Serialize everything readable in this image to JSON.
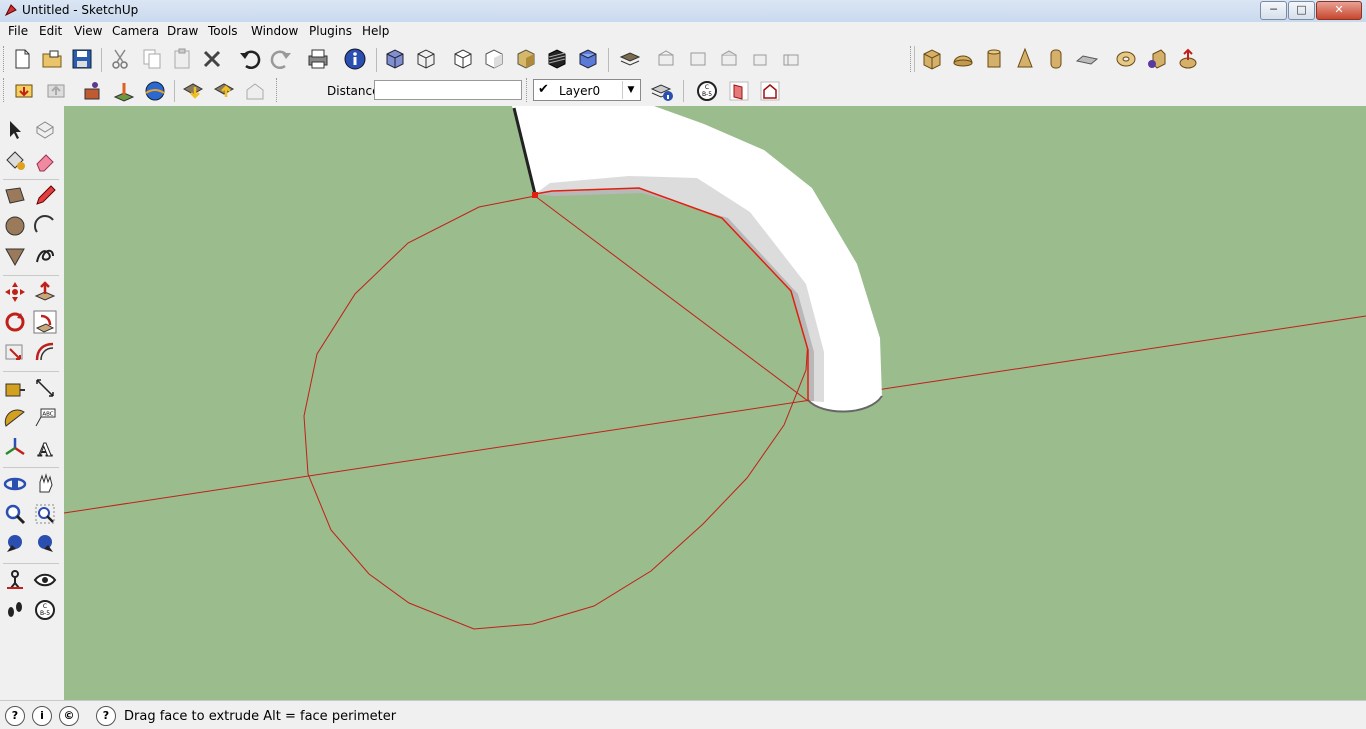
{
  "window": {
    "title": "Untitled - SketchUp",
    "minimize": "─",
    "maximize": "□",
    "close": "✕"
  },
  "menu": [
    "File",
    "Edit",
    "View",
    "Camera",
    "Draw",
    "Tools",
    "Window",
    "Plugins",
    "Help"
  ],
  "measurements": {
    "label": "Distance",
    "value": ""
  },
  "layers": {
    "current": "Layer0",
    "visible_check": "✔",
    "dropdown": "▼"
  },
  "status": {
    "geo_icon": "?",
    "credits_icon": "i",
    "license_icon": "©",
    "help_icon": "?",
    "text": "Drag face to extrude  Alt = face perimeter"
  },
  "colors": {
    "viewport_bg": "#9bbc8d",
    "axis_red": "#c0201a",
    "selection_red": "#e02010",
    "pipe_white": "#ffffff"
  }
}
